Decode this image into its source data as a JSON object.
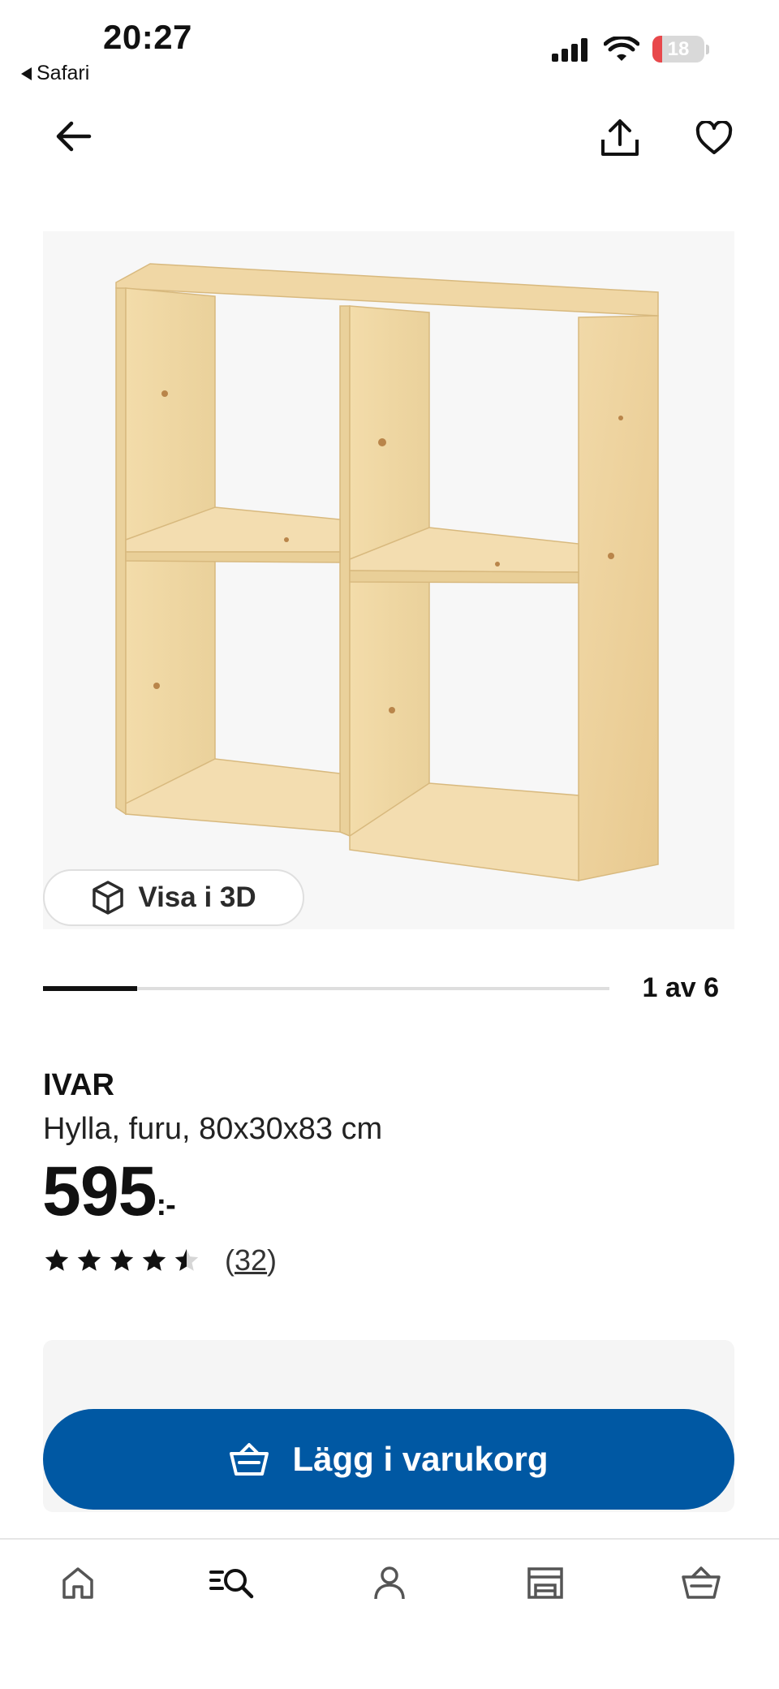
{
  "status_bar": {
    "time": "20:27",
    "back_app_label": "Safari",
    "battery_level": "18",
    "battery_fraction": 0.18,
    "battery_color": "#e8484b"
  },
  "nav": {
    "back_icon": "arrow-left-icon",
    "share_icon": "share-icon",
    "favorite_icon": "heart-icon"
  },
  "gallery": {
    "view_3d_label": "Visa i 3D",
    "page_count": "1 av 6",
    "current_image": 1,
    "total_images": 6
  },
  "product": {
    "brand": "IVAR",
    "description": "Hylla, furu, 80x30x83 cm",
    "price": "595",
    "price_suffix": ":-",
    "rating": 4.5,
    "rating_max": 5,
    "review_count": "32"
  },
  "cart": {
    "button_label": "Lägg i varukorg",
    "button_color": "#0058a3"
  },
  "tab_bar": {
    "items": [
      {
        "name": "home",
        "icon": "home-icon"
      },
      {
        "name": "search",
        "icon": "search-icon",
        "active": true
      },
      {
        "name": "profile",
        "icon": "person-icon"
      },
      {
        "name": "stores",
        "icon": "store-icon"
      },
      {
        "name": "cart",
        "icon": "basket-icon"
      }
    ]
  }
}
